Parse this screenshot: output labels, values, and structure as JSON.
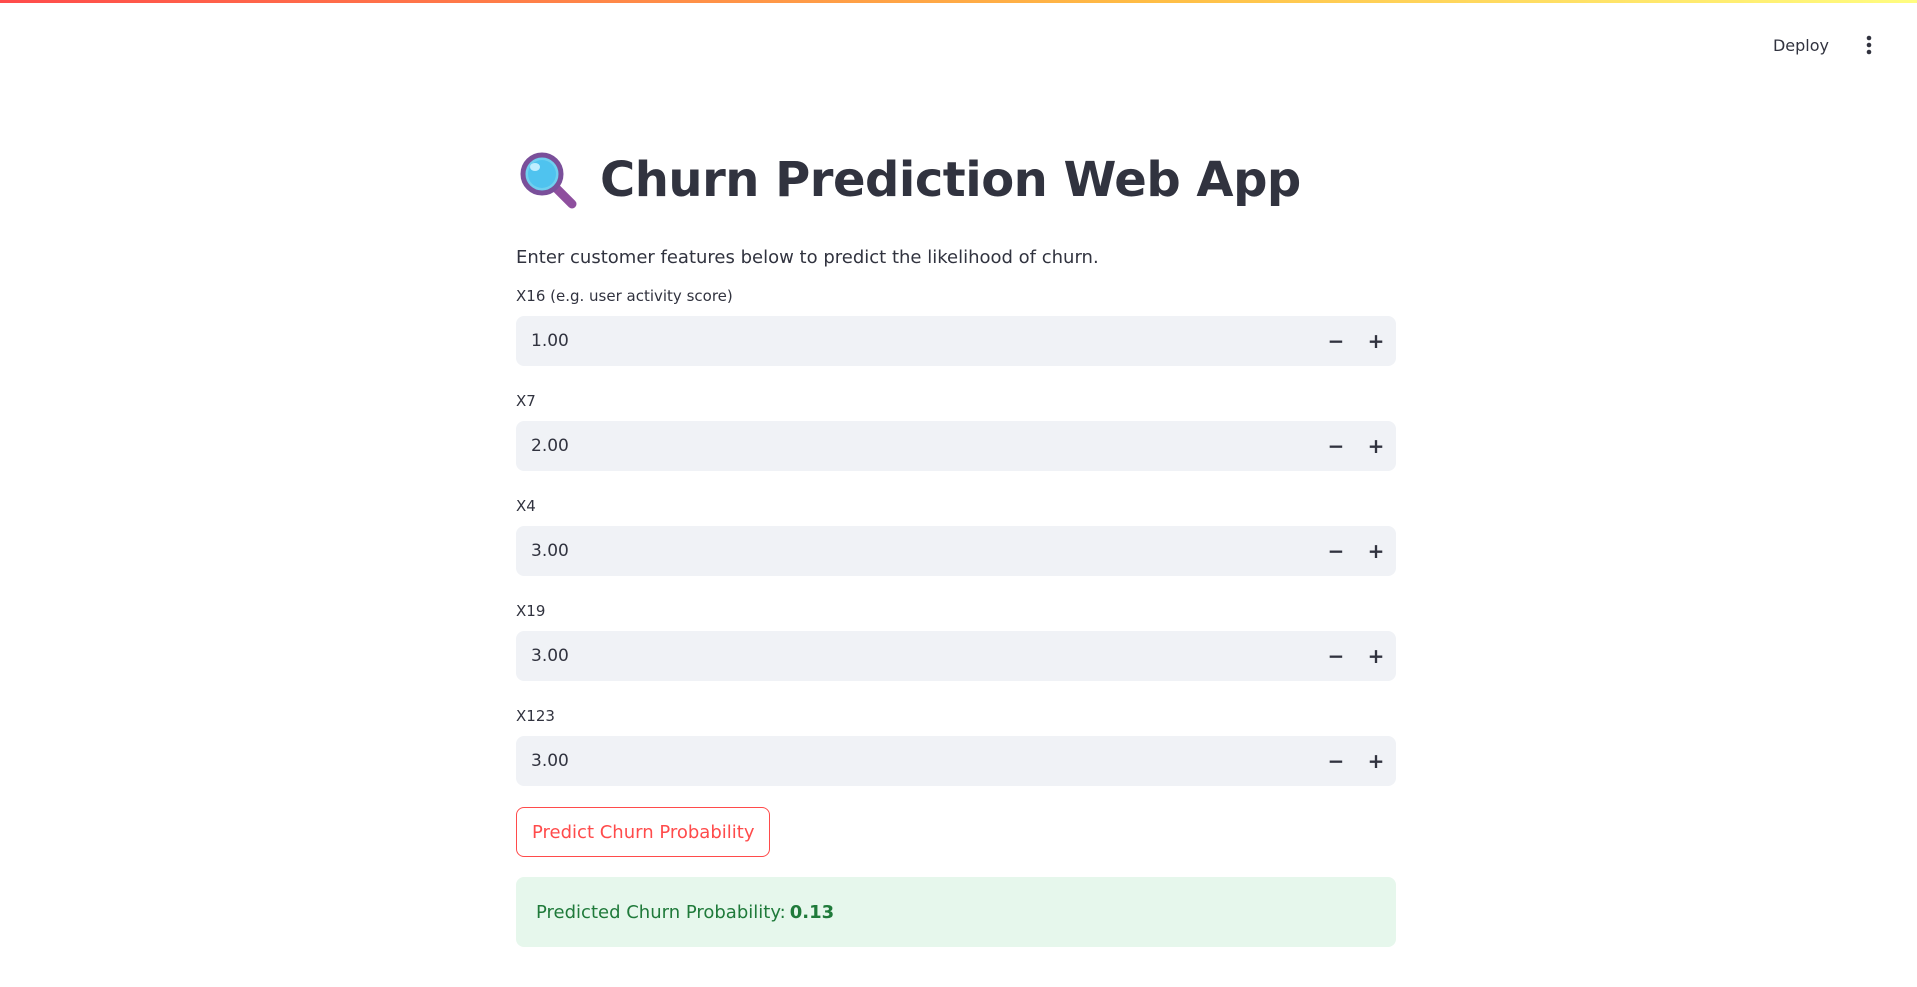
{
  "header": {
    "deploy_label": "Deploy",
    "menu_icon": "kebab-menu-icon"
  },
  "main": {
    "title_icon": "magnifying-glass-icon",
    "title": "Churn Prediction Web App",
    "subtitle": "Enter customer features below to predict the likelihood of churn.",
    "fields": [
      {
        "label": "X16 (e.g. user activity score)",
        "value": "1.00"
      },
      {
        "label": "X7",
        "value": "2.00"
      },
      {
        "label": "X4",
        "value": "3.00"
      },
      {
        "label": "X19",
        "value": "3.00"
      },
      {
        "label": "X123",
        "value": "3.00"
      }
    ],
    "stepper": {
      "minus": "−",
      "plus": "+"
    },
    "predict_button": "Predict Churn Probability",
    "result": {
      "label": "Predicted Churn Probability:",
      "value": "0.13"
    }
  },
  "colors": {
    "accent": "#ff4b4b",
    "input_bg": "#f0f2f6",
    "success_bg": "#e6f7ec",
    "success_text": "#1f7a3a"
  }
}
